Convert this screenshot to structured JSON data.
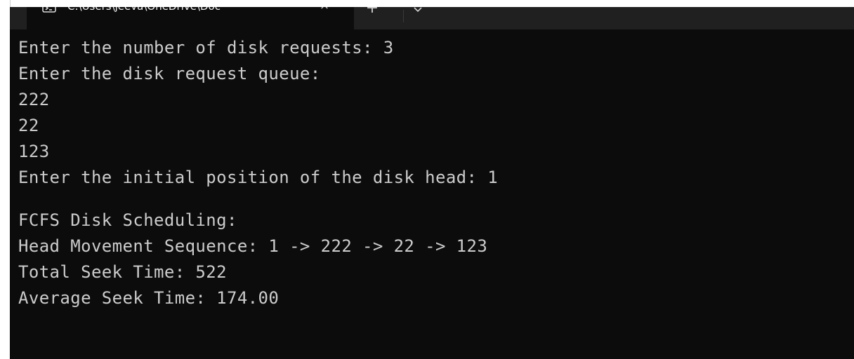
{
  "tab": {
    "title": "C:\\Users\\jeeva\\OneDrive\\Doc",
    "close_glyph": "×",
    "new_tab_glyph": "+"
  },
  "console": {
    "lines": [
      "Enter the number of disk requests: 3",
      "Enter the disk request queue:",
      "222",
      "22",
      "123",
      "Enter the initial position of the disk head: 1",
      "",
      "FCFS Disk Scheduling:",
      "Head Movement Sequence: 1 -> 222 -> 22 -> 123",
      "Total Seek Time: 522",
      "Average Seek Time: 174.00"
    ]
  },
  "colors": {
    "terminal_bg": "#0c0c0c",
    "terminal_fg": "#cccccc",
    "tabbar_bg": "#202020"
  }
}
